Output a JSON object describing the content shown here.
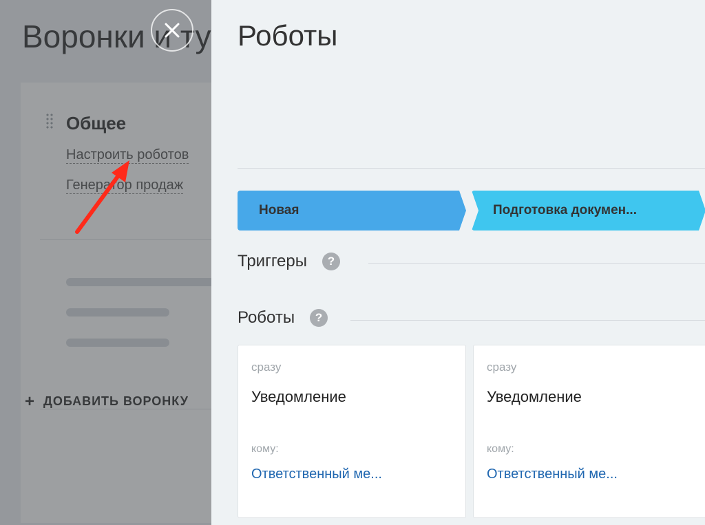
{
  "background": {
    "title": "Воронки и ту",
    "card": {
      "title": "Общее",
      "links": [
        "Настроить роботов",
        "Генератор продаж"
      ]
    },
    "add_funnel_label": "ДОБАВИТЬ ВОРОНКУ"
  },
  "close_icon": "close-icon",
  "panel": {
    "title": "Роботы",
    "stages": [
      {
        "label": "Новая",
        "color": "#47a8e9"
      },
      {
        "label": "Подготовка докумен...",
        "color": "#3fc6ef"
      }
    ],
    "triggers_label": "Триггеры",
    "robots_label": "Роботы",
    "help_icon_text": "?",
    "robot_cards": [
      {
        "delay": "сразу",
        "name": "Уведомление",
        "to_label": "кому:",
        "to_value": "Ответственный ме..."
      },
      {
        "delay": "сразу",
        "name": "Уведомление",
        "to_label": "кому:",
        "to_value": "Ответственный ме..."
      }
    ]
  },
  "annotation_arrow_color": "#ff2a1a"
}
